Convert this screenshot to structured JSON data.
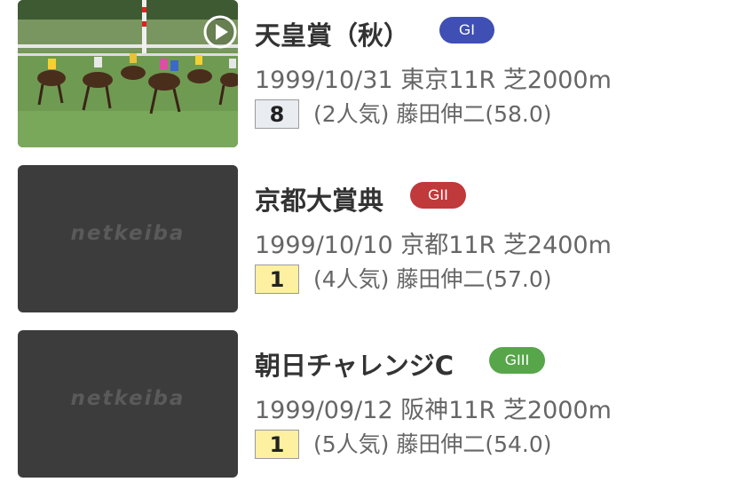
{
  "races": [
    {
      "title": "天皇賞（秋）",
      "grade": "GI",
      "grade_color": "#3f4fb3",
      "info": "1999/10/31 東京11R 芝2000m",
      "rank": "8",
      "rank_bg": "#e9edf2",
      "detail": "(2人気) 藤田伸二(58.0)",
      "thumbnail": "video-thumbnail",
      "play_icon": "play-icon"
    },
    {
      "title": "京都大賞典",
      "grade": "GII",
      "grade_color": "#c0393b",
      "info": "1999/10/10 京都11R 芝2400m",
      "rank": "1",
      "rank_bg": "#fdf0a0",
      "detail": "(4人気) 藤田伸二(57.0)",
      "thumbnail_logo": "netkeiba"
    },
    {
      "title": "朝日チャレンジC",
      "grade": "GIII",
      "grade_color": "#57a64a",
      "info": "1999/09/12 阪神11R 芝2000m",
      "rank": "1",
      "rank_bg": "#fdf0a0",
      "detail": "(5人気) 藤田伸二(54.0)",
      "thumbnail_logo": "netkeiba"
    }
  ]
}
